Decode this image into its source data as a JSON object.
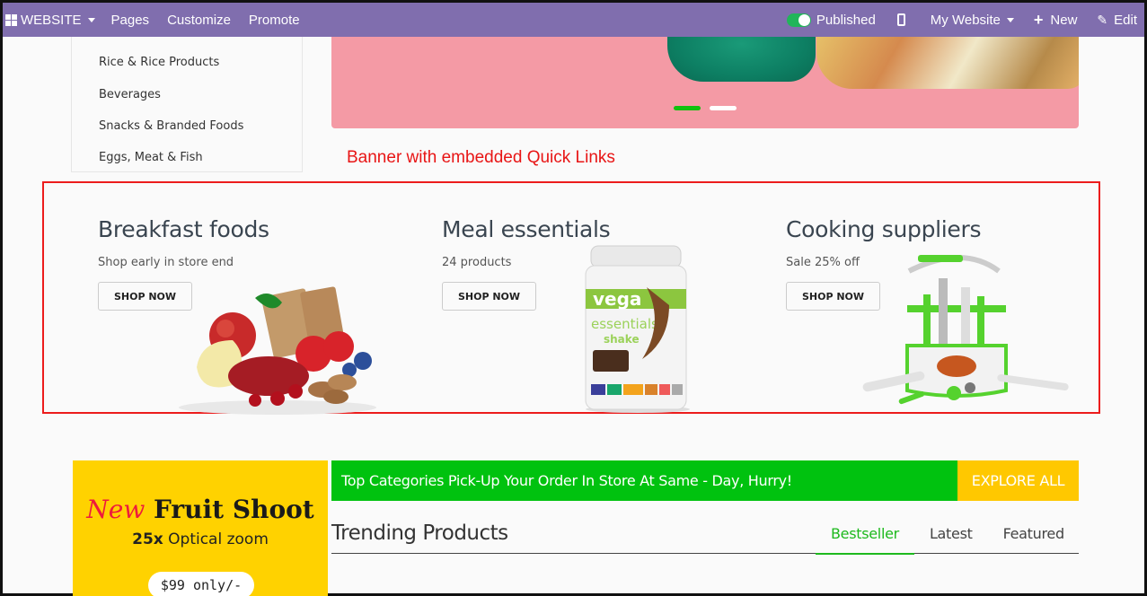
{
  "topbar": {
    "left": [
      {
        "label": "WEBSITE",
        "icon": "apps-grid-icon",
        "dropdown": true
      },
      {
        "label": "Pages"
      },
      {
        "label": "Customize"
      },
      {
        "label": "Promote"
      }
    ],
    "published_label": "Published",
    "published_on": true,
    "website_label": "My Website",
    "new_label": "New",
    "edit_label": "Edit"
  },
  "categories": [
    "Rice & Rice Products",
    "Beverages",
    "Snacks & Branded Foods",
    "Eggs, Meat & Fish"
  ],
  "hero": {
    "slides": 2,
    "active_slide": 1,
    "colors": {
      "background": "#f49aa5",
      "active_dot": "#0fc10f"
    }
  },
  "annotation": "Banner with embedded Quick Links",
  "quick_links": [
    {
      "title": "Breakfast foods",
      "subtitle": "Shop early in store end",
      "button": "SHOP NOW",
      "image": "breakfast-foods-image"
    },
    {
      "title": "Meal essentials",
      "subtitle": "24 products",
      "button": "SHOP NOW",
      "image": "vega-shake-image"
    },
    {
      "title": "Cooking suppliers",
      "subtitle": "Sale 25% off",
      "button": "SHOP NOW",
      "image": "kitchen-utensils-image"
    }
  ],
  "promo": {
    "title_accent": "New",
    "title_rest": "Fruit Shoot",
    "subtitle_bold": "25x",
    "subtitle_rest": "Optical zoom",
    "price": "$99 only/-"
  },
  "strip": {
    "text": "Top Categories Pick-Up Your Order In Store At Same - Day, Hurry!",
    "button": "EXPLORE ALL"
  },
  "trending": {
    "title": "Trending Products",
    "tabs": [
      "Bestseller",
      "Latest",
      "Featured"
    ],
    "active_tab": "Bestseller"
  }
}
